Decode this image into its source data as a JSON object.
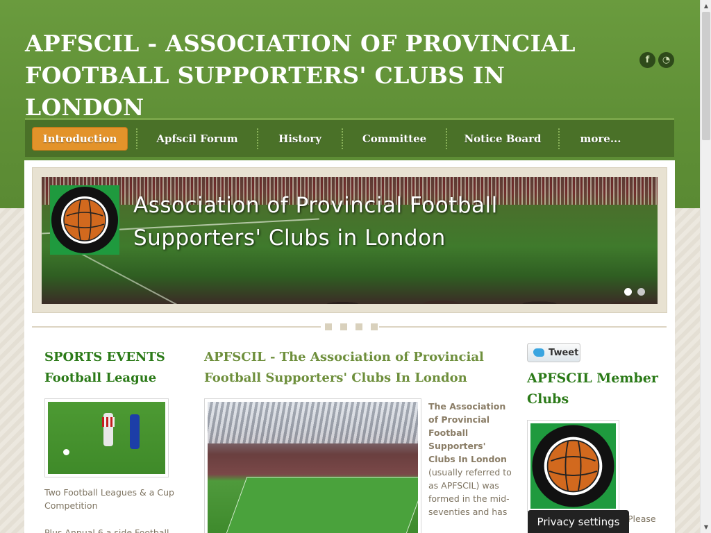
{
  "header": {
    "site_title": "APFSCIL - ASSOCIATION OF PROVINCIAL FOOTBALL SUPPORTERS' CLUBS IN LONDON",
    "social": [
      {
        "icon": "facebook-icon",
        "glyph": "f"
      },
      {
        "icon": "rss-icon",
        "glyph": "◔"
      }
    ]
  },
  "nav": {
    "items": [
      {
        "label": "Introduction",
        "active": true
      },
      {
        "label": "Apfscil Forum"
      },
      {
        "label": "History"
      },
      {
        "label": "Committee"
      },
      {
        "label": "Notice Board"
      },
      {
        "label": "more..."
      }
    ]
  },
  "banner": {
    "title": "Association of Provincial Football Supporters' Clubs in London",
    "slides": 2,
    "active_slide": 1
  },
  "left_column": {
    "heading": "SPORTS EVENTS Football League",
    "paragraph1": "Two Football Leagues & a Cup Competition",
    "paragraph2": "Plus Annual 6 a side Football"
  },
  "middle_column": {
    "heading": "APFSCIL - The Association of Provincial Football Supporters' Clubs In London",
    "intro_bold": "The Association of Provincial Football Supporters' Clubs In London",
    "intro_rest": " (usually referred to as APFSCIL) was formed in the mid-seventies and has"
  },
  "right_column": {
    "tweet_label": "Tweet",
    "heading": "APFSCIL Member Clubs",
    "trailing_text": "Please"
  },
  "privacy": {
    "label": "Privacy settings"
  },
  "colors": {
    "header_green": "#6a9b3e",
    "nav_green": "#4a7128",
    "active_orange": "#e3932a",
    "heading_green": "#2b7a18"
  }
}
